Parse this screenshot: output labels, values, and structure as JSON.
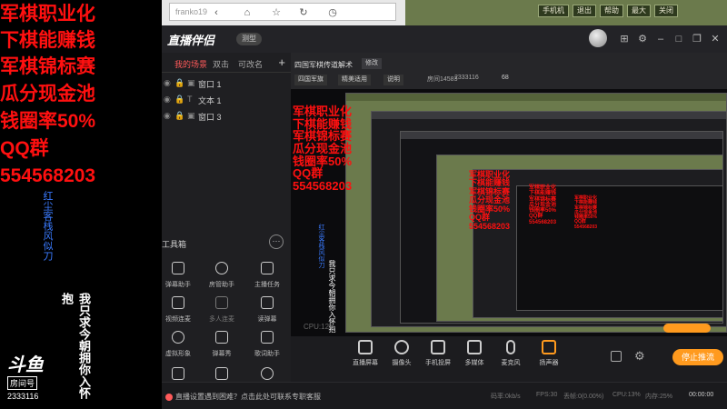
{
  "overlay": {
    "promo_lines": [
      "军棋职业化",
      "下棋能赚钱",
      "军棋锦标赛",
      "瓜分现金池",
      "钱圈率50%",
      "QQ群",
      "554568203"
    ],
    "vertical_blue": "红尘客栈风似刀",
    "vertical_white": "我只求今朝拥你入怀抱",
    "room_logo": "斗鱼",
    "room_label": "房间号",
    "room_id": "2333116"
  },
  "top_strip": {
    "search_text": "franko19"
  },
  "app": {
    "brand": "直播伴侣",
    "version": "测型",
    "scene_tabs": [
      "我的场景",
      "双击",
      "可改名"
    ],
    "sources": [
      "窗口 1",
      "文本 1",
      "窗口 3"
    ],
    "tools_label": "工具箱",
    "tools": [
      "弹幕助手",
      "房管助手",
      "主播任务",
      "视频连麦",
      "多人连麦",
      "读弹幕",
      "虚拟形象",
      "弹幕秀",
      "歌词助手"
    ],
    "stream_title": "四国军棋传道解术",
    "edit_label": "修改",
    "category": "四国军旗",
    "quality": "精美适用",
    "explain": "说明",
    "room_number": "房间14583",
    "viewers": "2333116",
    "heat": "68",
    "bottom_buttons": [
      "直播屏幕",
      "摄像头",
      "手机投屏",
      "多媒体",
      "麦克风",
      "扬声器"
    ],
    "go_live": "停止推流",
    "notice": "直播设置遇到困难？点击此处可联系专职客服",
    "status": {
      "bitrate": "码率:0kb/s",
      "fps": "FPS:30",
      "dropped": "丢帧:0(0.00%)",
      "cpu": "CPU:13%",
      "memory": "内存:25%",
      "time": "00:00:00"
    },
    "cpu_inner": "CPU:12%"
  },
  "game": {
    "buttons": [
      "手机机",
      "退出",
      "帮助",
      "最大",
      "关闭"
    ]
  },
  "colors": {
    "promo_red": "#ff1010",
    "blue_text": "#3a7bff",
    "accent_orange": "#ff9a1e",
    "scene_active": "#ff5a5a"
  }
}
